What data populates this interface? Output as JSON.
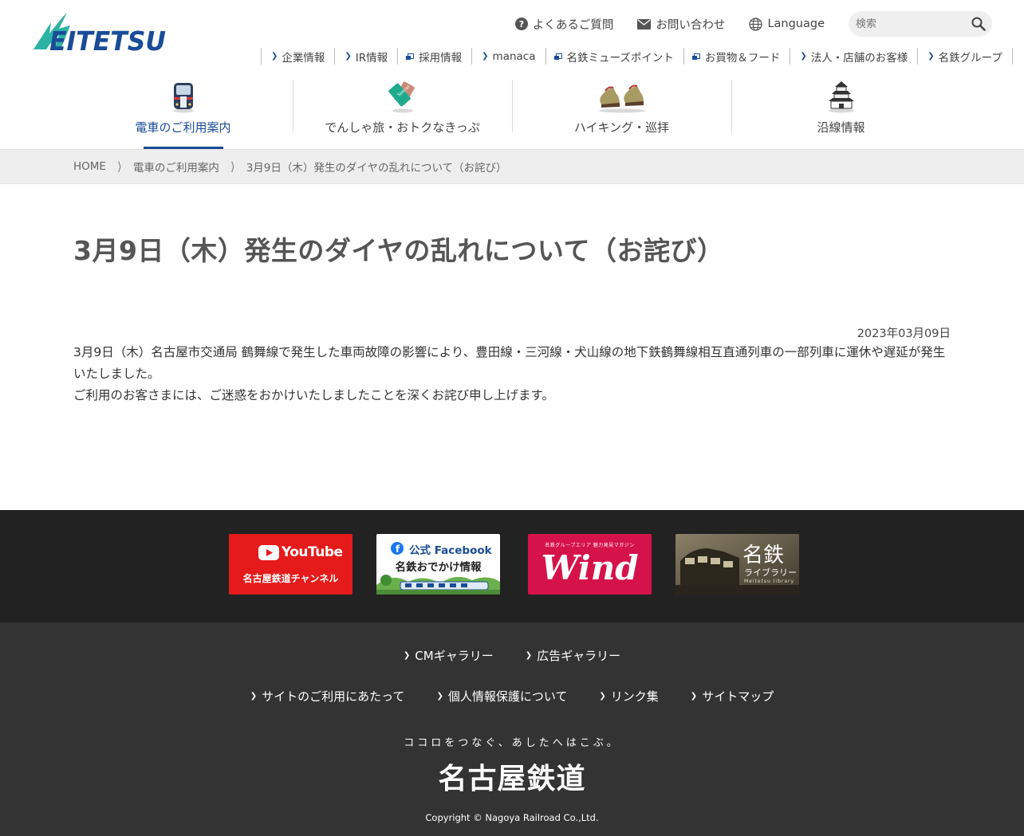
{
  "header": {
    "logo_text": "MEITETSU",
    "utility": {
      "faq": "よくあるご質問",
      "contact": "お問い合わせ",
      "language": "Language",
      "search_placeholder": "検索"
    },
    "sublinks": [
      {
        "label": "企業情報",
        "icon": "chevron-icon"
      },
      {
        "label": "IR情報",
        "icon": "chevron-icon"
      },
      {
        "label": "採用情報",
        "icon": "external-link-icon"
      },
      {
        "label": "manaca",
        "icon": "chevron-icon"
      },
      {
        "label": "名鉄ミューズポイント",
        "icon": "external-link-icon"
      },
      {
        "label": "お買物＆フード",
        "icon": "external-link-icon"
      },
      {
        "label": "法人・店舗のお客様",
        "icon": "chevron-icon"
      },
      {
        "label": "名鉄グループ",
        "icon": "chevron-icon"
      }
    ],
    "global_nav": [
      {
        "label": "電車のご利用案内",
        "icon": "train-icon",
        "active": true
      },
      {
        "label": "でんしゃ旅・おトクなきっぷ",
        "icon": "ticket-icon",
        "active": false
      },
      {
        "label": "ハイキング・巡拝",
        "icon": "hiking-boots-icon",
        "active": false
      },
      {
        "label": "沿線情報",
        "icon": "castle-icon",
        "active": false
      }
    ]
  },
  "breadcrumb": [
    "HOME",
    "電車のご利用案内",
    "3月9日（木）発生のダイヤの乱れについて（お詫び）"
  ],
  "article": {
    "title": "3月9日（木）発生のダイヤの乱れについて（お詫び）",
    "date": "2023年03月09日",
    "paragraph1": "3月9日（木）名古屋市交通局 鶴舞線で発生した車両故障の影響により、豊田線・三河線・犬山線の地下鉄鶴舞線相互直通列車の一部列車に運休や遅延が発生いたしました。",
    "paragraph2": "ご利用のお客さまには、ご迷惑をおかけいたしましたことを深くお詫び申し上げます。"
  },
  "banners": {
    "youtube": {
      "title": "YouTube",
      "subtitle": "名古屋鉄道チャンネル"
    },
    "facebook": {
      "title": "公式 Facebook",
      "subtitle": "名鉄おでかけ情報"
    },
    "wind": {
      "kicker": "名鉄グループエリア 魅力発見マガジン",
      "title": "Wind"
    },
    "library": {
      "title": "名鉄",
      "subtitle": "ライブラリー",
      "roman": "Meitetsu library"
    }
  },
  "footer": {
    "links_row1": [
      "CMギャラリー",
      "広告ギャラリー"
    ],
    "links_row2": [
      "サイトのご利用にあたって",
      "個人情報保護について",
      "リンク集",
      "サイトマップ"
    ],
    "tagline": "ココロをつなぐ、あしたへはこぶ。",
    "corp_name": "名古屋鉄道",
    "copyright": "Copyright © Nagoya Railroad Co.,Ltd."
  },
  "colors": {
    "brand_blue": "#1a4c98",
    "logo_green": "#2bb3a3",
    "youtube_red": "#e51a1a",
    "wind_pink": "#d6124b",
    "footer_dark": "#333333",
    "banner_band": "#222222"
  }
}
